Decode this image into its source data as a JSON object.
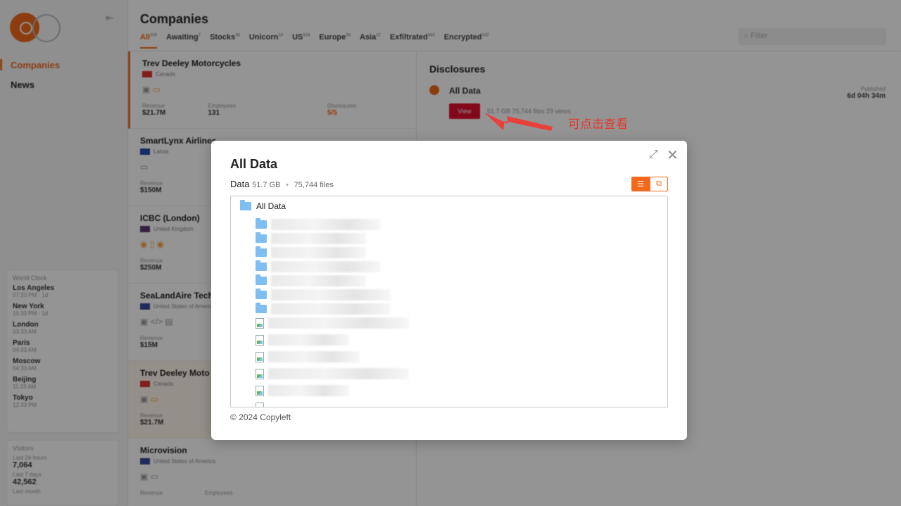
{
  "sidebar": {
    "nav": [
      {
        "label": "Companies"
      },
      {
        "label": "News"
      }
    ],
    "world_clock": {
      "title": "World Clock",
      "cities": [
        {
          "name": "Los Angeles",
          "time": "07:33 PM · 1d"
        },
        {
          "name": "New York",
          "time": "10:33 PM · 1d"
        },
        {
          "name": "London",
          "time": "03:33 AM"
        },
        {
          "name": "Paris",
          "time": "04:33 AM"
        },
        {
          "name": "Moscow",
          "time": "04:33 AM"
        },
        {
          "name": "Beijing",
          "time": "11:33 AM"
        },
        {
          "name": "Tokyo",
          "time": "12:33 PM"
        }
      ]
    },
    "visitors": {
      "title": "Visitors",
      "items": [
        {
          "label": "Last 24 hours",
          "value": "7,064"
        },
        {
          "label": "Last 7 days",
          "value": "42,562"
        },
        {
          "label": "Last month",
          "value": ""
        }
      ]
    }
  },
  "header": {
    "title": "Companies",
    "filter_placeholder": "Filter",
    "tabs": [
      {
        "label": "All",
        "count": "159"
      },
      {
        "label": "Awaiting",
        "count": "7"
      },
      {
        "label": "Stocks",
        "count": "38"
      },
      {
        "label": "Unicorn",
        "count": "10"
      },
      {
        "label": "US",
        "count": "104"
      },
      {
        "label": "Europe",
        "count": "36"
      },
      {
        "label": "Asia",
        "count": "17"
      },
      {
        "label": "Exfiltrated",
        "count": "103"
      },
      {
        "label": "Encrypted",
        "count": "147"
      }
    ]
  },
  "companies": [
    {
      "name": "Trev Deeley Motorcycles",
      "country": "Canada",
      "revenue_label": "Revenue",
      "revenue": "$21.7M",
      "employees_label": "Employees",
      "employees": "131",
      "disclosures_label": "Disclosures",
      "disclosures": "5/5"
    },
    {
      "name": "SmartLynx Airlines",
      "country": "Latvia",
      "revenue_label": "Revenue",
      "revenue": "$150M",
      "employees_label": "",
      "employees": "",
      "disclosures_label": "",
      "disclosures": ""
    },
    {
      "name": "ICBC (London)",
      "country": "United Kingdom",
      "revenue_label": "Revenue",
      "revenue": "$250M",
      "employees_label": "",
      "employees": "",
      "disclosures_label": "",
      "disclosures": ""
    },
    {
      "name": "SeaLandAire Tech",
      "country": "United States of America",
      "revenue_label": "Revenue",
      "revenue": "$15M",
      "employees_label": "",
      "employees": "",
      "disclosures_label": "",
      "disclosures": ""
    },
    {
      "name": "Trev Deeley Moto",
      "country": "Canada",
      "revenue_label": "Revenue",
      "revenue": "$21.7M",
      "employees_label": "",
      "employees": "",
      "disclosures_label": "",
      "disclosures": ""
    },
    {
      "name": "Microvision",
      "country": "United States of America",
      "revenue_label": "Revenue",
      "revenue": "",
      "employees_label": "Employees",
      "employees": "",
      "disclosures_label": "",
      "disclosures": ""
    }
  ],
  "detail": {
    "title": "Disclosures",
    "item_name": "All Data",
    "view_label": "View",
    "meta": "51.7 GB   75,744 files   29 views",
    "published_label": "Published",
    "published_value": "6d 04h 34m"
  },
  "annotation": {
    "text": "可点击查看",
    "color": "#e4372f"
  },
  "modal": {
    "title": "All Data",
    "subtitle_label": "Data",
    "size": "51.7 GB",
    "separator": "•",
    "files": "75,744 files",
    "tree_root": "All Data",
    "footer": "© 2024 Copyleft"
  },
  "colors": {
    "accent": "#f26a1b",
    "view_button": "#e0102e",
    "folder": "#7fbef0"
  }
}
